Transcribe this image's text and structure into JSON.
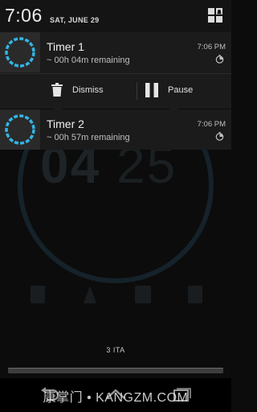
{
  "status": {
    "clock": "7:06",
    "date": "SAT, JUNE 29"
  },
  "notifications": [
    {
      "title": "Timer 1",
      "subtitle": "~ 00h 04m remaining",
      "time": "7:06 PM",
      "actions": [
        {
          "label": "Dismiss",
          "icon": "trash-icon"
        },
        {
          "label": "Pause",
          "icon": "pause-icon"
        }
      ]
    },
    {
      "title": "Timer 2",
      "subtitle": "~ 00h 57m remaining",
      "time": "7:06 PM"
    }
  ],
  "background_app": {
    "time_main": "04",
    "time_secondary": "25",
    "timer_label": "3 ITA"
  },
  "watermark": "康掌门 • KANGZM.COM",
  "colors": {
    "accent": "#33b5e5",
    "notification_bg": "#1b1b1b",
    "icon_bg": "#2a2a2a"
  }
}
